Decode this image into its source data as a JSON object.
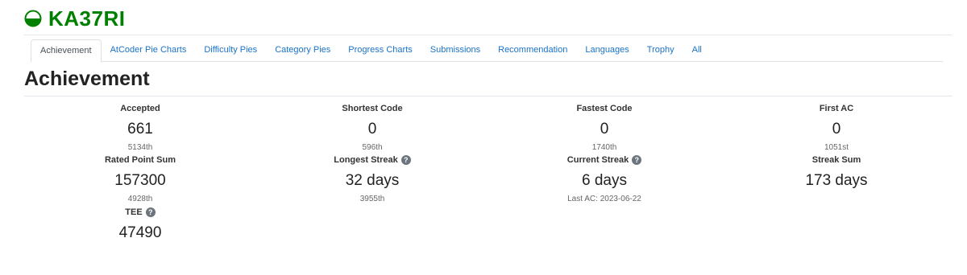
{
  "user": {
    "name": "KA37RI",
    "rating_color": "#008000"
  },
  "tabs": [
    {
      "label": "Achievement",
      "active": true
    },
    {
      "label": "AtCoder Pie Charts"
    },
    {
      "label": "Difficulty Pies"
    },
    {
      "label": "Category Pies"
    },
    {
      "label": "Progress Charts"
    },
    {
      "label": "Submissions"
    },
    {
      "label": "Recommendation"
    },
    {
      "label": "Languages"
    },
    {
      "label": "Trophy"
    },
    {
      "label": "All"
    }
  ],
  "page": {
    "title": "Achievement"
  },
  "stats": {
    "accepted": {
      "label": "Accepted",
      "value": "661",
      "rank": "5134th"
    },
    "shortest_code": {
      "label": "Shortest Code",
      "value": "0",
      "rank": "596th"
    },
    "fastest_code": {
      "label": "Fastest Code",
      "value": "0",
      "rank": "1740th"
    },
    "first_ac": {
      "label": "First AC",
      "value": "0",
      "rank": "1051st"
    },
    "rated_point_sum": {
      "label": "Rated Point Sum",
      "value": "157300",
      "rank": "4928th"
    },
    "longest_streak": {
      "label": "Longest Streak",
      "value": "32 days",
      "rank": "3955th"
    },
    "current_streak": {
      "label": "Current Streak",
      "value": "6 days",
      "rank": "Last AC: 2023-06-22"
    },
    "streak_sum": {
      "label": "Streak Sum",
      "value": "173 days"
    },
    "tee": {
      "label": "TEE",
      "value": "47490"
    }
  }
}
